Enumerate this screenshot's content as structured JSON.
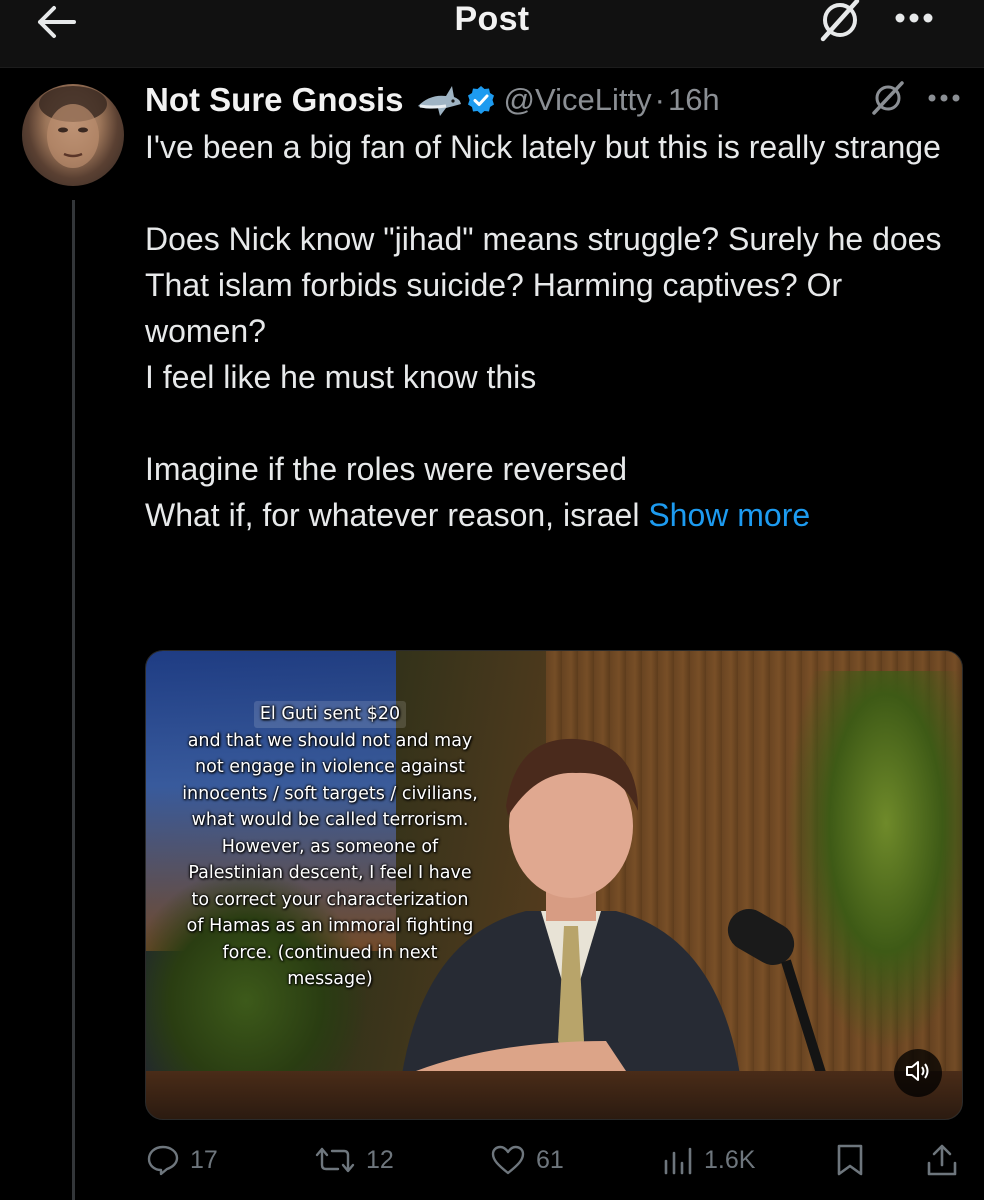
{
  "topbar": {
    "title": "Post"
  },
  "author": {
    "display_name": "Not Sure Gnosis",
    "handle": "@ViceLitty",
    "separator": "·",
    "time": "16h"
  },
  "post": {
    "lines": [
      "I've been a big fan of Nick lately but this is really strange",
      "",
      "Does Nick know \"jihad\" means struggle? Surely he does",
      "That islam forbids suicide? Harming captives? Or women?",
      "I feel like he must know this",
      "",
      "Imagine if the roles were reversed"
    ],
    "last_line": "What if, for whatever reason, israel",
    "show_more": "Show more"
  },
  "media": {
    "caption_donor": "El Guti sent $20",
    "caption_lines": [
      "and that we should not and may",
      "not engage in violence against",
      "innocents / soft targets / civilians,",
      "what would be called terrorism.",
      "However, as someone of",
      "Palestinian descent, I feel I have",
      "to correct your characterization",
      "of Hamas as an immoral fighting",
      "force. (continued in next",
      "message)"
    ]
  },
  "actions": {
    "replies": "17",
    "reposts": "12",
    "likes": "61",
    "views": "1.6K"
  },
  "colors": {
    "accent": "#1d9bf0",
    "muted": "#6e767d",
    "background": "#000000"
  },
  "icons": {
    "back": "arrow-left-icon",
    "grok": "grok-icon",
    "more": "more-horizontal-icon",
    "verified": "verified-badge-icon",
    "shark": "shark-emoji-icon",
    "volume": "volume-icon",
    "reply": "reply-icon",
    "repost": "repost-icon",
    "like": "heart-icon",
    "views": "views-icon",
    "bookmark": "bookmark-icon",
    "share": "share-icon"
  }
}
